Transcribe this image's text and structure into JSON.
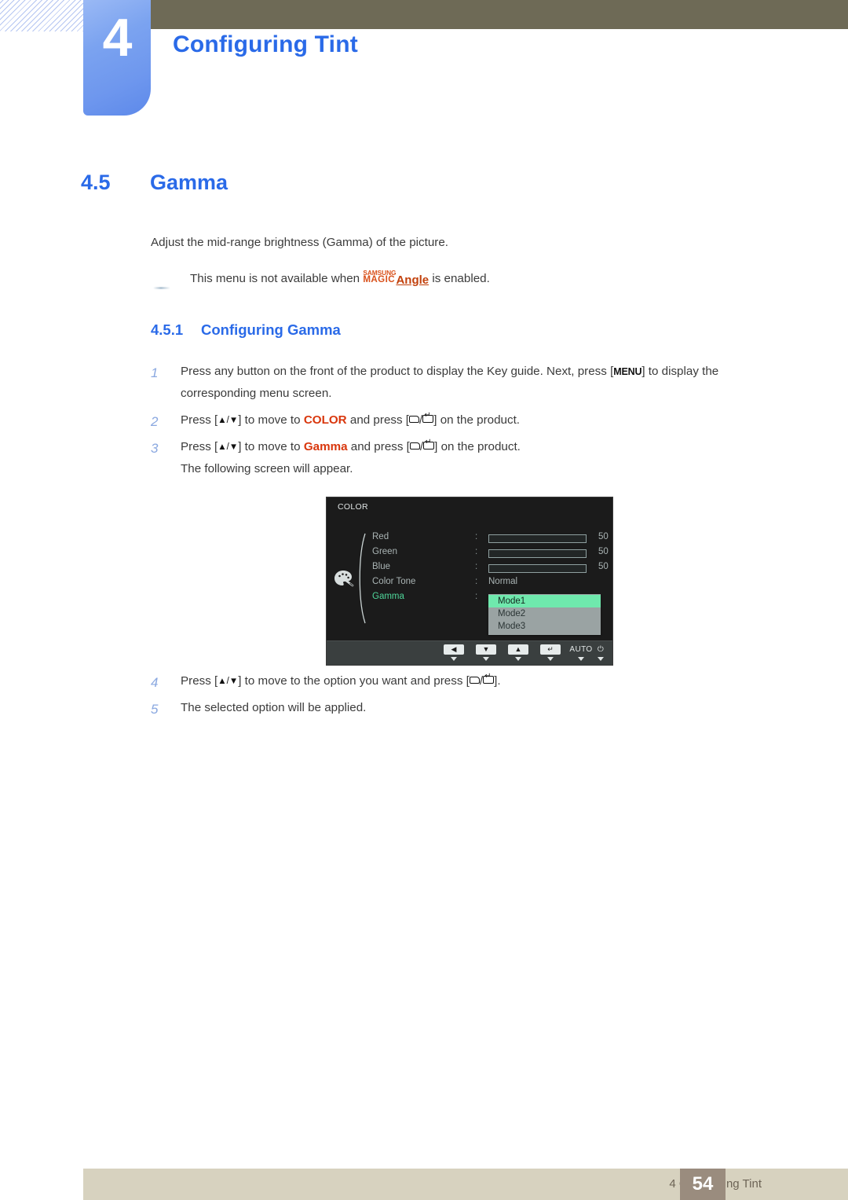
{
  "chapter": {
    "number": "4",
    "title": "Configuring Tint"
  },
  "section": {
    "number": "4.5",
    "title": "Gamma"
  },
  "intro": "Adjust the mid-range brightness (Gamma) of the picture.",
  "note": {
    "prefix": "This menu is not available when ",
    "logo_samsung": "SAMSUNG",
    "logo_magic": "MAGIC",
    "logo_angle": "Angle",
    "suffix": " is enabled."
  },
  "subsection": {
    "number": "4.5.1",
    "title": "Configuring Gamma"
  },
  "steps": [
    {
      "index": "1",
      "part_a": "Press any button on the front of the product to display the Key guide. Next, press [",
      "key": "MENU",
      "part_b": "] to display the corresponding menu screen."
    },
    {
      "index": "2",
      "part_a": "Press [",
      "arrows": "▲/▼",
      "part_b": "] to move to ",
      "keyword": "COLOR",
      "part_c": " and press [",
      "part_d": "] on the product."
    },
    {
      "index": "3",
      "part_a": "Press [",
      "arrows": "▲/▼",
      "part_b": "] to move to ",
      "keyword": "Gamma",
      "part_c": " and press [",
      "part_d": "] on the product.",
      "follow_up": "The following screen will appear."
    },
    {
      "index": "4",
      "part_a": "Press [",
      "arrows": "▲/▼",
      "part_b": "] to move to the option you want and press [",
      "part_d": "]."
    },
    {
      "index": "5",
      "text": "The selected option will be applied."
    }
  ],
  "osd": {
    "title": "COLOR",
    "rows": [
      {
        "label": "Red",
        "colon": ":",
        "type": "bar",
        "fill_percent": 50,
        "value": "50"
      },
      {
        "label": "Green",
        "colon": ":",
        "type": "bar",
        "fill_percent": 50,
        "value": "50"
      },
      {
        "label": "Blue",
        "colon": ":",
        "type": "bar",
        "fill_percent": 50,
        "value": "50"
      },
      {
        "label": "Color Tone",
        "colon": ":",
        "type": "text",
        "value": "Normal"
      },
      {
        "label": "Gamma",
        "colon": ":",
        "type": "dropdown"
      }
    ],
    "dropdown_options": [
      {
        "label": "Mode1",
        "selected": true
      },
      {
        "label": "Mode2",
        "selected": false
      },
      {
        "label": "Mode3",
        "selected": false
      }
    ],
    "footer_keys": [
      {
        "name": "left-key",
        "glyph": "◀",
        "kind": "box"
      },
      {
        "name": "down-key",
        "glyph": "▼",
        "kind": "box"
      },
      {
        "name": "up-key",
        "glyph": "▲",
        "kind": "box"
      },
      {
        "name": "enter-key",
        "glyph": "↵",
        "kind": "box"
      },
      {
        "name": "auto-key",
        "glyph": "AUTO",
        "kind": "text"
      },
      {
        "name": "power-key",
        "glyph": "⏻",
        "kind": "text"
      }
    ]
  },
  "footer": {
    "label": "4 Configuring Tint",
    "page": "54"
  },
  "colors": {
    "accent_blue": "#2a6ae8",
    "header_olive": "#6e6a56",
    "keyword_red": "#d9360c",
    "magic_orange": "#d9501a",
    "osd_highlight": "#6fe9ad",
    "footer_bar": "#d7d2bf",
    "footer_page": "#9a8c7e"
  }
}
